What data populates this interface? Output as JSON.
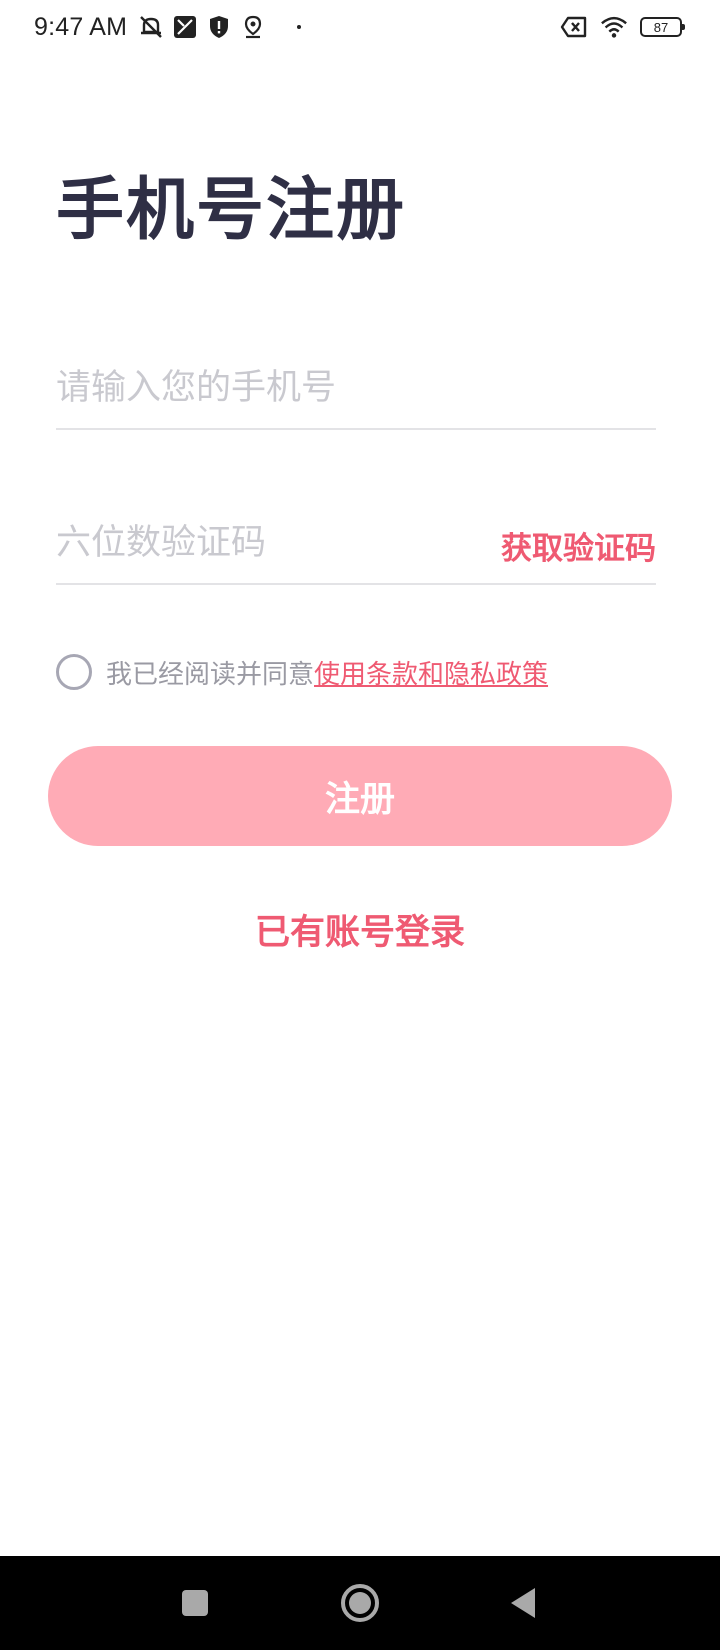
{
  "status_bar": {
    "time": "9:47 AM",
    "icons": [
      "mute-icon",
      "screen-off-icon",
      "shield-icon",
      "location-icon",
      "dot-icon"
    ],
    "right_icons": [
      "sim-missing-icon",
      "wifi-icon",
      "battery-icon"
    ],
    "battery_level": "87"
  },
  "page": {
    "title": "手机号注册"
  },
  "form": {
    "phone_placeholder": "请输入您的手机号",
    "phone_value": "",
    "code_placeholder": "六位数验证码",
    "code_value": "",
    "get_code_label": "获取验证码"
  },
  "agreement": {
    "checked": false,
    "text": "我已经阅读并同意",
    "link_text": "使用条款和隐私政策"
  },
  "actions": {
    "register_label": "注册",
    "login_link_label": "已有账号登录"
  },
  "colors": {
    "accent": "#ef5a72",
    "button_disabled": "#ffabb6",
    "title": "#2f2f45"
  },
  "nav_bar": {
    "buttons": [
      "recents-icon",
      "home-icon",
      "back-icon"
    ]
  }
}
